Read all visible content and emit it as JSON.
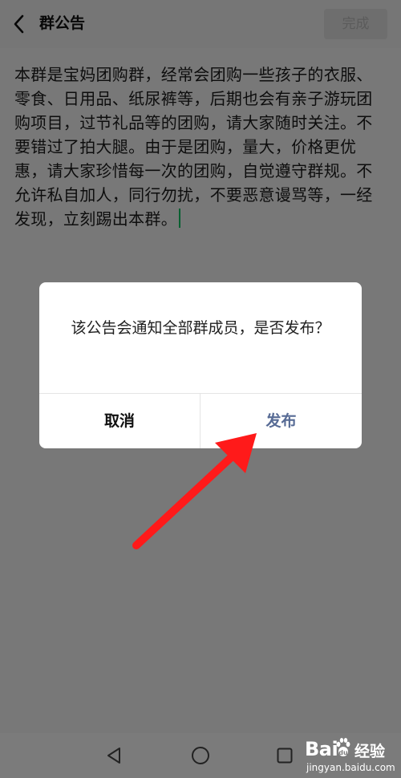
{
  "header": {
    "title": "群公告",
    "done_label": "完成"
  },
  "editor": {
    "text": "本群是宝妈团购群，经常会团购一些孩子的衣服、零食、日用品、纸尿裤等，后期也会有亲子游玩团购项目，过节礼品等的团购，请大家随时关注。不要错过了拍大腿。由于是团购，量大，价格更优惠，请大家珍惜每一次的团购，自觉遵守群规。不允许私自加人，同行勿扰，不要恶意谩骂等，一经发现，立刻踢出本群。"
  },
  "dialog": {
    "message": "该公告会通知全部群成员，是否发布？",
    "cancel_label": "取消",
    "publish_label": "发布"
  },
  "navbar": {
    "icons": [
      "back-triangle-icon",
      "home-circle-icon",
      "recent-square-icon"
    ]
  },
  "watermark": {
    "logo": "Bai",
    "logo_cn": "经验",
    "url": "jingyan.baidu.com"
  },
  "colors": {
    "accent_link": "#576b95",
    "cursor": "#07c160",
    "arrow": "#ff1a1a"
  }
}
